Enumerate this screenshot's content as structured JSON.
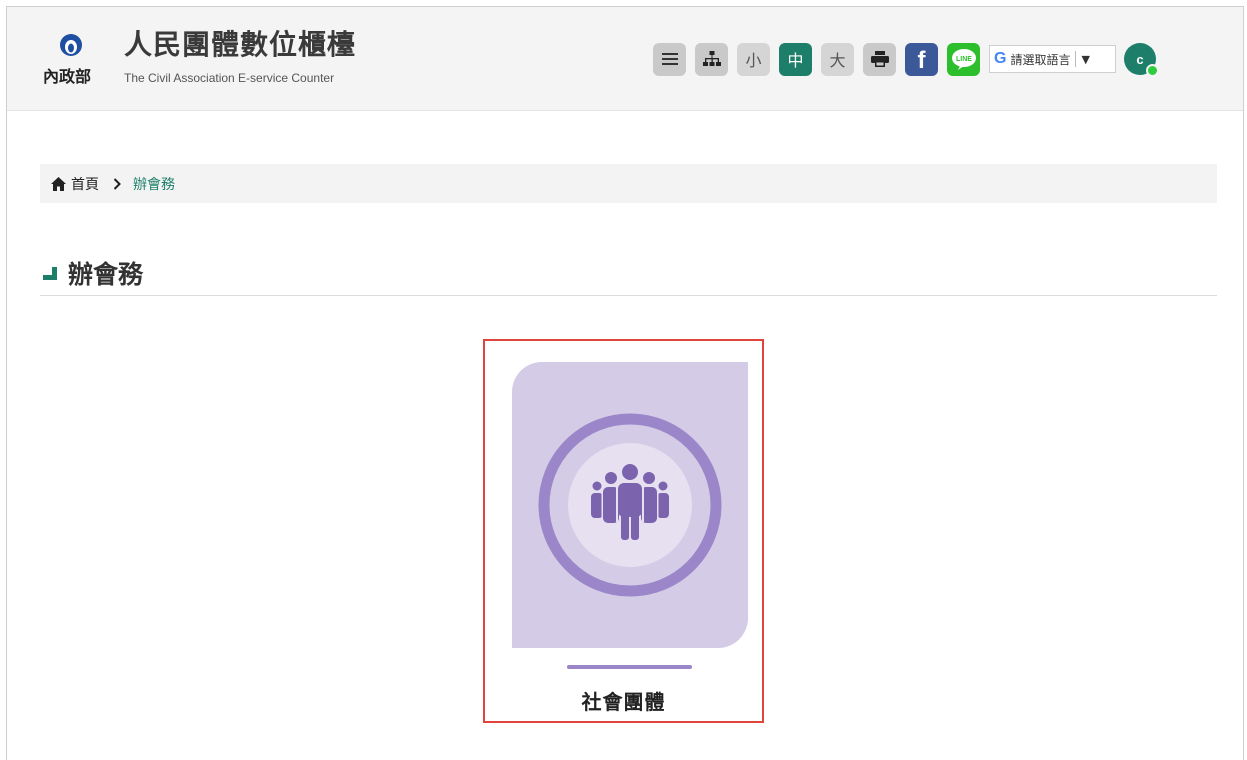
{
  "header": {
    "logo_text": "內政部",
    "title": "人民團體數位櫃檯",
    "subtitle": "The Civil Association E-service Counter"
  },
  "toolbar": {
    "menu_icon": "hamburger-icon",
    "sitemap_icon": "sitemap-icon",
    "font_small": "小",
    "font_medium": "中",
    "font_large": "大",
    "print_icon": "print-icon",
    "facebook_label": "f",
    "line_label": "LINE",
    "language_g": "G",
    "language_label": "請選取語言",
    "language_arrow": "▼",
    "user_initial": "c"
  },
  "breadcrumb": {
    "home": "首頁",
    "current": "辦會務"
  },
  "page": {
    "title": "辦會務"
  },
  "card": {
    "label": "社會團體",
    "icon": "people-group-icon"
  },
  "colors": {
    "accent": "#1d7f6a",
    "card_bg": "#d4cbe6",
    "card_ring": "#9a86c9",
    "highlight": "#e0453d"
  }
}
